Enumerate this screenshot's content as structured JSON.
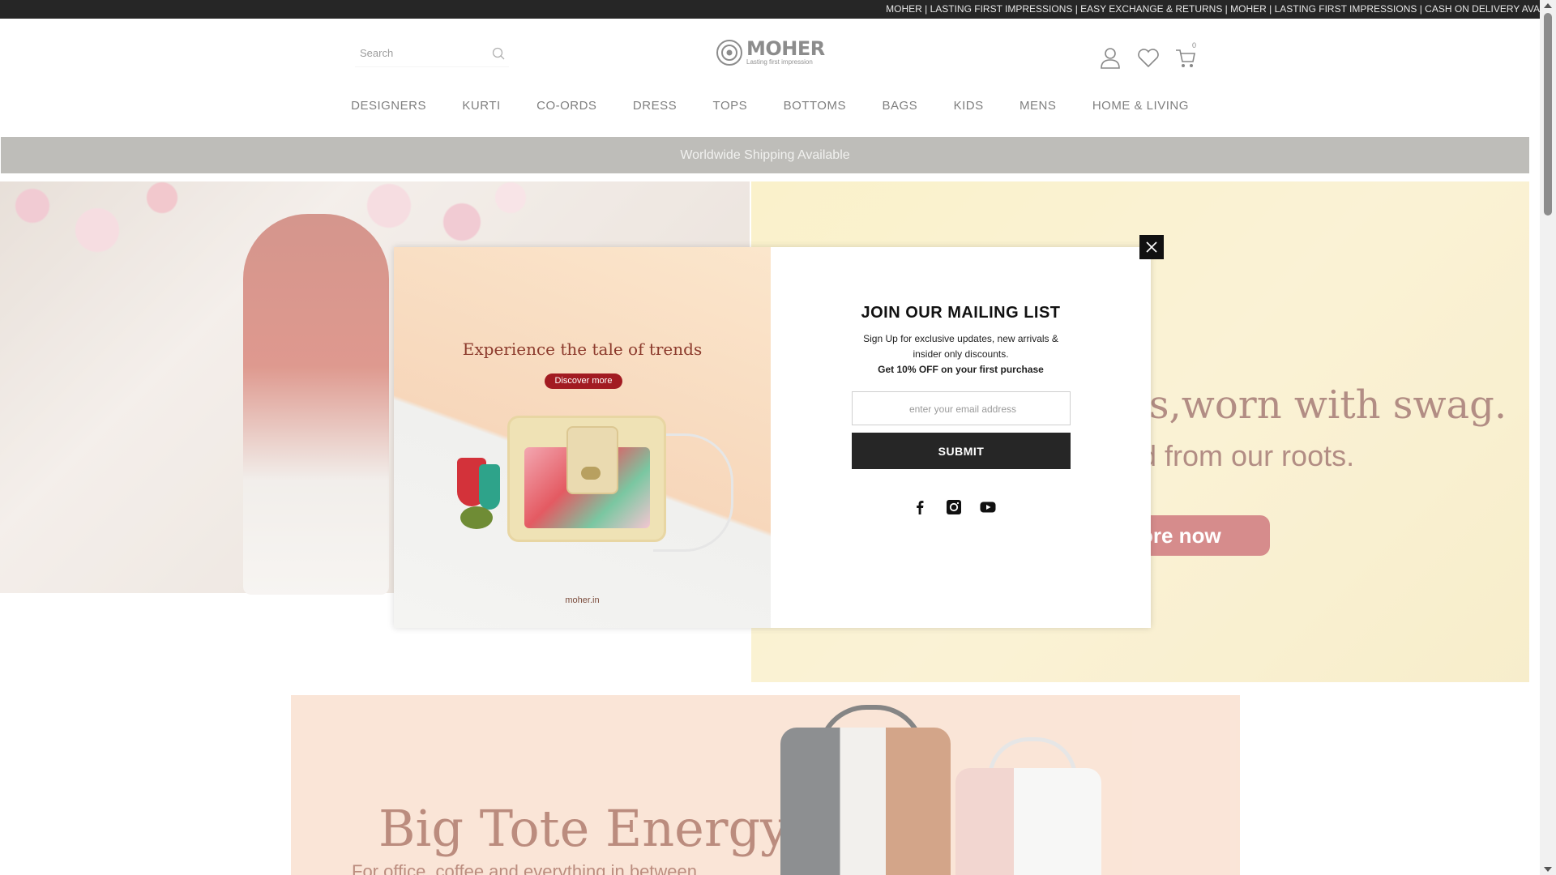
{
  "announcement": {
    "text": "MOHER | LASTING FIRST IMPRESSIONS | EASY EXCHANGE & RETURNS | MOHER | LASTING FIRST IMPRESSIONS | CASH ON DELIVERY AVA"
  },
  "header": {
    "search_placeholder": "Search",
    "logo_text": "MOHER",
    "logo_tagline": "Lasting first impression",
    "cart_count": "0",
    "icons": [
      "account-icon",
      "wishlist-heart-icon",
      "cart-icon"
    ]
  },
  "nav": {
    "items": [
      "DESIGNERS",
      "KURTI",
      "CO-ORDS",
      "DRESS",
      "TOPS",
      "BOTTOMS",
      "BAGS",
      "KIDS",
      "MENS",
      "HOME & LIVING"
    ]
  },
  "shipping_bar": {
    "text": "Worldwide Shipping Available"
  },
  "hero": {
    "headline": "ns,worn with swag.",
    "subheadline": "d from our roots.",
    "cta_label": "ore now"
  },
  "tote_banner": {
    "title": "Big Tote Energy",
    "subtitle": "For office, coffee and everything in between"
  },
  "popup": {
    "image_heading": "Experience the tale of trends",
    "image_button": "Discover more",
    "image_url_text": "moher.in",
    "title": "JOIN OUR MAILING LIST",
    "description": "Sign Up for exclusive updates, new arrivals & insider only discounts.",
    "offer": "Get 10% OFF on your first purchase",
    "email_placeholder": "enter your email address",
    "submit_label": "SUBMIT",
    "social": [
      "facebook-icon",
      "instagram-icon",
      "youtube-icon"
    ]
  },
  "colors": {
    "topbar": "#262626",
    "shipping_bar": "#8f8e87",
    "submit_button": "#262626",
    "discover_button": "#a21b22"
  }
}
